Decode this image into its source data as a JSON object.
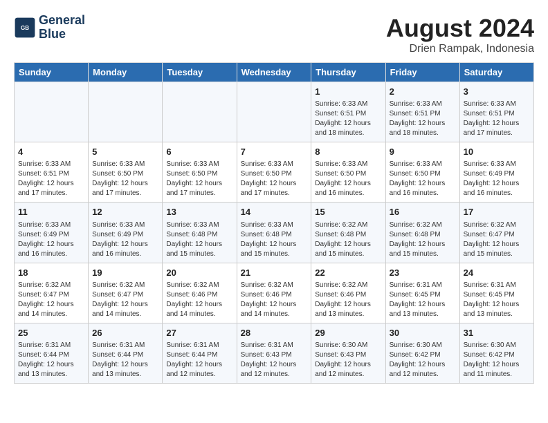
{
  "logo": {
    "line1": "General",
    "line2": "Blue"
  },
  "title": {
    "month_year": "August 2024",
    "location": "Drien Rampak, Indonesia"
  },
  "weekdays": [
    "Sunday",
    "Monday",
    "Tuesday",
    "Wednesday",
    "Thursday",
    "Friday",
    "Saturday"
  ],
  "weeks": [
    [
      {
        "day": "",
        "info": ""
      },
      {
        "day": "",
        "info": ""
      },
      {
        "day": "",
        "info": ""
      },
      {
        "day": "",
        "info": ""
      },
      {
        "day": "1",
        "info": "Sunrise: 6:33 AM\nSunset: 6:51 PM\nDaylight: 12 hours\nand 18 minutes."
      },
      {
        "day": "2",
        "info": "Sunrise: 6:33 AM\nSunset: 6:51 PM\nDaylight: 12 hours\nand 18 minutes."
      },
      {
        "day": "3",
        "info": "Sunrise: 6:33 AM\nSunset: 6:51 PM\nDaylight: 12 hours\nand 17 minutes."
      }
    ],
    [
      {
        "day": "4",
        "info": "Sunrise: 6:33 AM\nSunset: 6:51 PM\nDaylight: 12 hours\nand 17 minutes."
      },
      {
        "day": "5",
        "info": "Sunrise: 6:33 AM\nSunset: 6:50 PM\nDaylight: 12 hours\nand 17 minutes."
      },
      {
        "day": "6",
        "info": "Sunrise: 6:33 AM\nSunset: 6:50 PM\nDaylight: 12 hours\nand 17 minutes."
      },
      {
        "day": "7",
        "info": "Sunrise: 6:33 AM\nSunset: 6:50 PM\nDaylight: 12 hours\nand 17 minutes."
      },
      {
        "day": "8",
        "info": "Sunrise: 6:33 AM\nSunset: 6:50 PM\nDaylight: 12 hours\nand 16 minutes."
      },
      {
        "day": "9",
        "info": "Sunrise: 6:33 AM\nSunset: 6:50 PM\nDaylight: 12 hours\nand 16 minutes."
      },
      {
        "day": "10",
        "info": "Sunrise: 6:33 AM\nSunset: 6:49 PM\nDaylight: 12 hours\nand 16 minutes."
      }
    ],
    [
      {
        "day": "11",
        "info": "Sunrise: 6:33 AM\nSunset: 6:49 PM\nDaylight: 12 hours\nand 16 minutes."
      },
      {
        "day": "12",
        "info": "Sunrise: 6:33 AM\nSunset: 6:49 PM\nDaylight: 12 hours\nand 16 minutes."
      },
      {
        "day": "13",
        "info": "Sunrise: 6:33 AM\nSunset: 6:48 PM\nDaylight: 12 hours\nand 15 minutes."
      },
      {
        "day": "14",
        "info": "Sunrise: 6:33 AM\nSunset: 6:48 PM\nDaylight: 12 hours\nand 15 minutes."
      },
      {
        "day": "15",
        "info": "Sunrise: 6:32 AM\nSunset: 6:48 PM\nDaylight: 12 hours\nand 15 minutes."
      },
      {
        "day": "16",
        "info": "Sunrise: 6:32 AM\nSunset: 6:48 PM\nDaylight: 12 hours\nand 15 minutes."
      },
      {
        "day": "17",
        "info": "Sunrise: 6:32 AM\nSunset: 6:47 PM\nDaylight: 12 hours\nand 15 minutes."
      }
    ],
    [
      {
        "day": "18",
        "info": "Sunrise: 6:32 AM\nSunset: 6:47 PM\nDaylight: 12 hours\nand 14 minutes."
      },
      {
        "day": "19",
        "info": "Sunrise: 6:32 AM\nSunset: 6:47 PM\nDaylight: 12 hours\nand 14 minutes."
      },
      {
        "day": "20",
        "info": "Sunrise: 6:32 AM\nSunset: 6:46 PM\nDaylight: 12 hours\nand 14 minutes."
      },
      {
        "day": "21",
        "info": "Sunrise: 6:32 AM\nSunset: 6:46 PM\nDaylight: 12 hours\nand 14 minutes."
      },
      {
        "day": "22",
        "info": "Sunrise: 6:32 AM\nSunset: 6:46 PM\nDaylight: 12 hours\nand 13 minutes."
      },
      {
        "day": "23",
        "info": "Sunrise: 6:31 AM\nSunset: 6:45 PM\nDaylight: 12 hours\nand 13 minutes."
      },
      {
        "day": "24",
        "info": "Sunrise: 6:31 AM\nSunset: 6:45 PM\nDaylight: 12 hours\nand 13 minutes."
      }
    ],
    [
      {
        "day": "25",
        "info": "Sunrise: 6:31 AM\nSunset: 6:44 PM\nDaylight: 12 hours\nand 13 minutes."
      },
      {
        "day": "26",
        "info": "Sunrise: 6:31 AM\nSunset: 6:44 PM\nDaylight: 12 hours\nand 13 minutes."
      },
      {
        "day": "27",
        "info": "Sunrise: 6:31 AM\nSunset: 6:44 PM\nDaylight: 12 hours\nand 12 minutes."
      },
      {
        "day": "28",
        "info": "Sunrise: 6:31 AM\nSunset: 6:43 PM\nDaylight: 12 hours\nand 12 minutes."
      },
      {
        "day": "29",
        "info": "Sunrise: 6:30 AM\nSunset: 6:43 PM\nDaylight: 12 hours\nand 12 minutes."
      },
      {
        "day": "30",
        "info": "Sunrise: 6:30 AM\nSunset: 6:42 PM\nDaylight: 12 hours\nand 12 minutes."
      },
      {
        "day": "31",
        "info": "Sunrise: 6:30 AM\nSunset: 6:42 PM\nDaylight: 12 hours\nand 11 minutes."
      }
    ]
  ]
}
